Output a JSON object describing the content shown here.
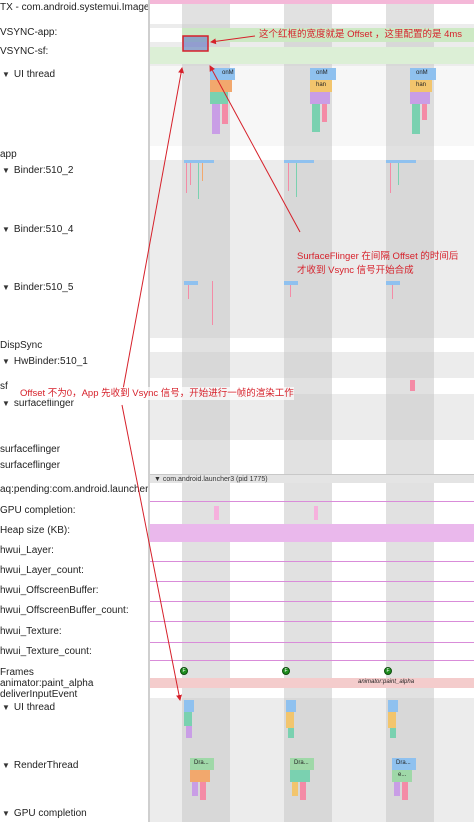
{
  "tracks": [
    {
      "label": "TX - com.android.systemui.Image\\",
      "arrow": ""
    },
    {
      "label": "VSYNC-app:",
      "arrow": ""
    },
    {
      "label": "VSYNC-sf:",
      "arrow": ""
    },
    {
      "label": "UI thread",
      "arrow": "▼"
    },
    {
      "label": "app",
      "arrow": ""
    },
    {
      "label": "Binder:510_2",
      "arrow": "▼"
    },
    {
      "label": "Binder:510_4",
      "arrow": "▼"
    },
    {
      "label": "Binder:510_5",
      "arrow": "▼"
    },
    {
      "label": "DispSync",
      "arrow": ""
    },
    {
      "label": "HwBinder:510_1",
      "arrow": "▼"
    },
    {
      "label": "sf",
      "arrow": ""
    },
    {
      "label": "surfaceflinger",
      "arrow": "▼"
    },
    {
      "label": "surfaceflinger",
      "arrow": ""
    },
    {
      "label": "surfaceflinger",
      "arrow": ""
    },
    {
      "label": "aq:pending:com.android.launcher3",
      "arrow": ""
    },
    {
      "label": "GPU completion:",
      "arrow": ""
    },
    {
      "label": "Heap size (KB):",
      "arrow": ""
    },
    {
      "label": "hwui_Layer:",
      "arrow": ""
    },
    {
      "label": "hwui_Layer_count:",
      "arrow": ""
    },
    {
      "label": "hwui_OffscreenBuffer:",
      "arrow": ""
    },
    {
      "label": "hwui_OffscreenBuffer_count:",
      "arrow": ""
    },
    {
      "label": "hwui_Texture:",
      "arrow": ""
    },
    {
      "label": "hwui_Texture_count:",
      "arrow": ""
    },
    {
      "label": "Frames",
      "arrow": ""
    },
    {
      "label": "animator:paint_alpha",
      "arrow": ""
    },
    {
      "label": "deliverInputEvent",
      "arrow": ""
    },
    {
      "label": "UI thread",
      "arrow": "▼"
    },
    {
      "label": "RenderThread",
      "arrow": "▼"
    },
    {
      "label": "GPU completion",
      "arrow": "▼"
    }
  ],
  "section_header": "▼ com.android.launcher3 (pid 1775)",
  "annotations": {
    "offset_box": "这个红框的宽度就是 Offset ，这里配置的是 4ms",
    "sf_line1": "SurfaceFlinger 在间隔 Offset 的时间后",
    "sf_line2": "才收到 Vsync 信号开始合成",
    "app_note": "Offset 不为0，App 先收到 Vsync 信号，开始进行一帧的渲染工作"
  },
  "slice_labels": {
    "ui_a": "onM",
    "ui_b": "han",
    "anim": "animator:paint_alpha",
    "frame_marker": "F",
    "draw": "Dra...",
    "e": "e..."
  }
}
